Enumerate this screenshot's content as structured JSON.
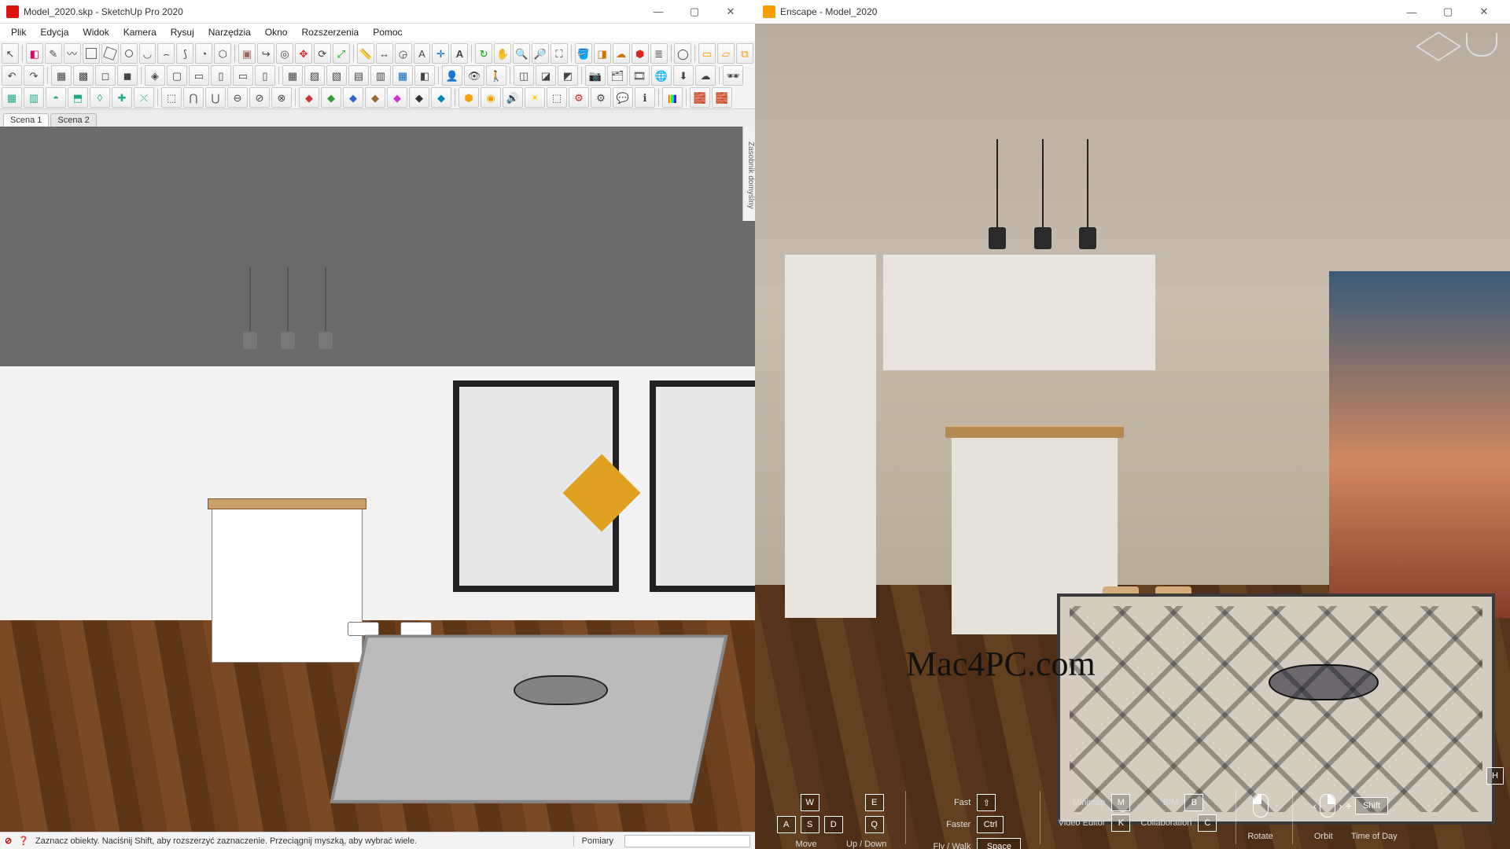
{
  "sketchup": {
    "title": "Model_2020.skp - SketchUp Pro 2020",
    "menus": [
      "Plik",
      "Edycja",
      "Widok",
      "Kamera",
      "Rysuj",
      "Narzędzia",
      "Okno",
      "Rozszerzenia",
      "Pomoc"
    ],
    "scene_tabs": [
      "Scena 1",
      "Scena 2"
    ],
    "tray_label": "Zasobnik domyślny",
    "status_hint": "Zaznacz obiekty. Naciśnij Shift, aby rozszerzyć zaznaczenie. Przeciągnij myszką, aby wybrać wiele.",
    "measure_label": "Pomiary",
    "measure_value": ""
  },
  "enscape": {
    "title": "Enscape - Model_2020",
    "watermark": "Mac4PC.com",
    "hud": {
      "help_key": "H",
      "move": {
        "keys_row1": [
          "W",
          "E"
        ],
        "keys_row2": [
          "A",
          "S",
          "D",
          "Q"
        ],
        "label": "Move",
        "label2": "Up / Down"
      },
      "speed": {
        "fast_label": "Fast",
        "fast_key": "⇧",
        "faster_label": "Faster",
        "faster_key": "Ctrl",
        "mode_label": "Fly /  Walk",
        "space_key": "Space"
      },
      "panels": {
        "minimap_label": "Minimap",
        "minimap_key": "M",
        "video_label": "Video Editor",
        "video_key": "K",
        "bim_label": "BIM",
        "bim_key": "B",
        "collab_label": "Collaboration",
        "collab_key": "C"
      },
      "mouse": {
        "rotate_label": "Rotate",
        "orbit_label": "Orbit",
        "tod_label": "Time of Day",
        "shift_key": "Shift"
      }
    }
  },
  "win_buttons": {
    "min": "—",
    "max": "▢",
    "close": "✕"
  }
}
